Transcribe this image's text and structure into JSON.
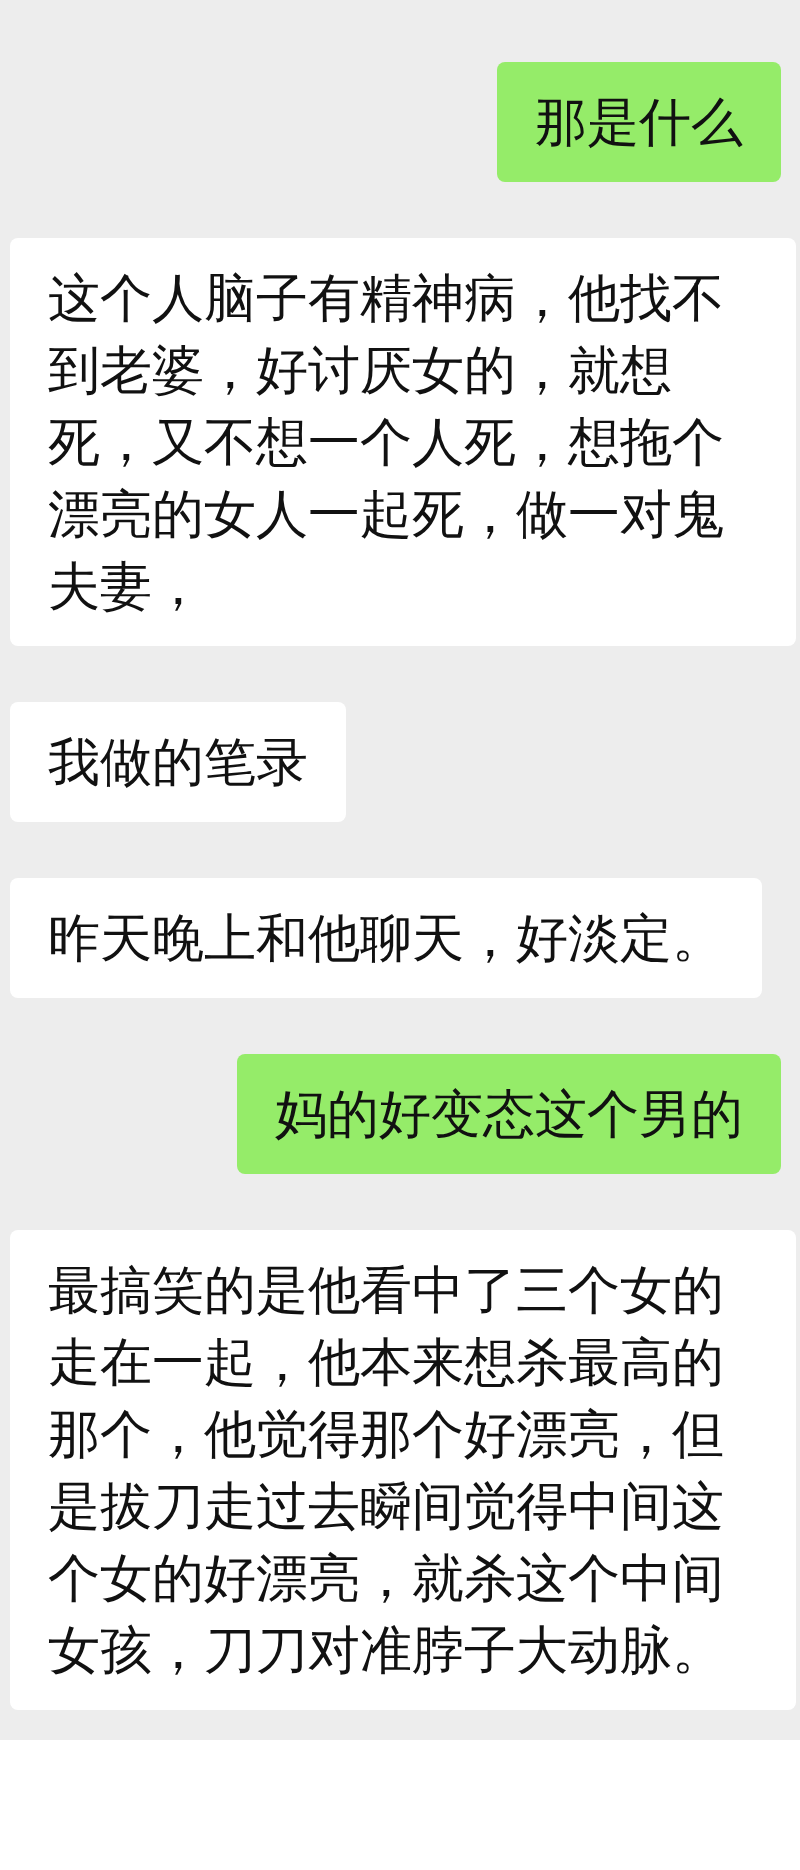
{
  "messages": [
    {
      "kind": "sent",
      "text": "那是什么"
    },
    {
      "kind": "received",
      "text": "这个人脑子有精神病，他找不到老婆，好讨厌女的，就想死，又不想一个人死，想拖个漂亮的女人一起死，做一对鬼夫妻，"
    },
    {
      "kind": "received",
      "text": "我做的笔录"
    },
    {
      "kind": "received",
      "text": "昨天晚上和他聊天，好淡定。"
    },
    {
      "kind": "sent",
      "text": "妈的好变态这个男的"
    },
    {
      "kind": "received",
      "text": "最搞笑的是他看中了三个女的走在一起，他本来想杀最高的那个，他觉得那个好漂亮，但是拔刀走过去瞬间觉得中间这个女的好漂亮，就杀这个中间女孩，刀刀对准脖子大动脉。"
    }
  ]
}
